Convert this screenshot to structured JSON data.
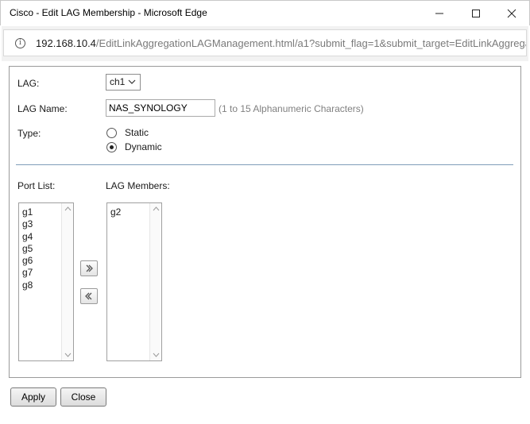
{
  "window": {
    "title": "Cisco - Edit LAG Membership - Microsoft Edge",
    "controls": [
      "minimize-icon",
      "maximize-icon",
      "close-icon"
    ]
  },
  "address_bar": {
    "host": "192.168.10.4",
    "path": "/EditLinkAggregationLAGManagement.html/a1?submit_flag=1&submit_target=EditLinkAggrega"
  },
  "form": {
    "lag_label": "LAG:",
    "lag_value": "ch1",
    "lag_name_label": "LAG Name:",
    "lag_name_value": "NAS_SYNOLOGY",
    "lag_name_hint": "(1 to 15 Alphanumeric Characters)",
    "type_label": "Type:",
    "type_options": [
      {
        "label": "Static",
        "checked": false
      },
      {
        "label": "Dynamic",
        "checked": true
      }
    ]
  },
  "ports": {
    "port_list_label": "Port List:",
    "lag_members_label": "LAG Members:",
    "port_list": [
      "g1",
      "g3",
      "g4",
      "g5",
      "g6",
      "g7",
      "g8"
    ],
    "lag_members": [
      "g2"
    ],
    "add_icon": "double-chevron-right-icon",
    "remove_icon": "double-chevron-left-icon"
  },
  "buttons": {
    "apply": "Apply",
    "close": "Close"
  }
}
